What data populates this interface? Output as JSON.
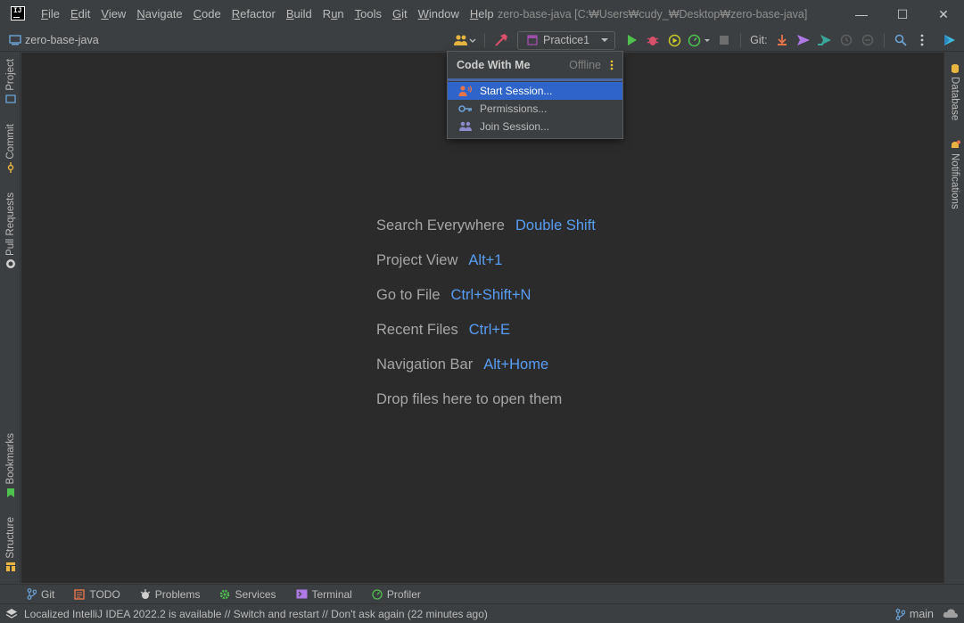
{
  "menu": [
    {
      "pre": "",
      "u": "F",
      "post": "ile"
    },
    {
      "pre": "",
      "u": "E",
      "post": "dit"
    },
    {
      "pre": "",
      "u": "V",
      "post": "iew"
    },
    {
      "pre": "",
      "u": "N",
      "post": "avigate"
    },
    {
      "pre": "",
      "u": "C",
      "post": "ode"
    },
    {
      "pre": "",
      "u": "R",
      "post": "efactor"
    },
    {
      "pre": "",
      "u": "B",
      "post": "uild"
    },
    {
      "pre": "R",
      "u": "u",
      "post": "n"
    },
    {
      "pre": "",
      "u": "T",
      "post": "ools"
    },
    {
      "pre": "",
      "u": "G",
      "post": "it"
    },
    {
      "pre": "",
      "u": "W",
      "post": "indow"
    },
    {
      "pre": "",
      "u": "H",
      "post": "elp"
    }
  ],
  "app_logo_text": "IJ",
  "window_title": "zero-base-java [C:₩Users₩cudy_₩Desktop₩zero-base-java]",
  "window_controls": {
    "minimize": "—",
    "maximize": "☐",
    "close": "✕"
  },
  "navbar": {
    "project_name": "zero-base-java",
    "run_config": "Practice1",
    "git_label": "Git:"
  },
  "left_tools": [
    "Project",
    "Commit",
    "Pull Requests",
    "Bookmarks",
    "Structure"
  ],
  "right_tools": [
    "Database",
    "Notifications"
  ],
  "hints": [
    {
      "action": "Search Everywhere",
      "key": "Double Shift"
    },
    {
      "action": "Project View",
      "key": "Alt+1"
    },
    {
      "action": "Go to File",
      "key": "Ctrl+Shift+N"
    },
    {
      "action": "Recent Files",
      "key": "Ctrl+E"
    },
    {
      "action": "Navigation Bar",
      "key": "Alt+Home"
    },
    {
      "action": "Drop files here to open them",
      "key": ""
    }
  ],
  "code_with_me": {
    "title": "Code With Me",
    "status": "Offline",
    "items": [
      {
        "label": "Start Session...",
        "icon": "start-session-icon",
        "selected": true
      },
      {
        "label": "Permissions...",
        "icon": "key-icon",
        "selected": false
      },
      {
        "label": "Join Session...",
        "icon": "join-session-icon",
        "selected": false
      }
    ]
  },
  "bottom_tabs": [
    {
      "label": "Git",
      "icon": "git-branch-icon"
    },
    {
      "label": "TODO",
      "icon": "todo-icon"
    },
    {
      "label": "Problems",
      "icon": "problems-icon"
    },
    {
      "label": "Services",
      "icon": "services-icon"
    },
    {
      "label": "Terminal",
      "icon": "terminal-icon"
    },
    {
      "label": "Profiler",
      "icon": "profiler-icon"
    }
  ],
  "status_bar": {
    "message": "Localized IntelliJ IDEA 2022.2 is available // Switch and restart // Don't ask again (22 minutes ago)",
    "branch": "main"
  },
  "colors": {
    "accent_blue": "#589df6",
    "selection": "#2f65ca",
    "editor_bg": "#2b2b2b",
    "chrome_bg": "#3c3f41"
  }
}
